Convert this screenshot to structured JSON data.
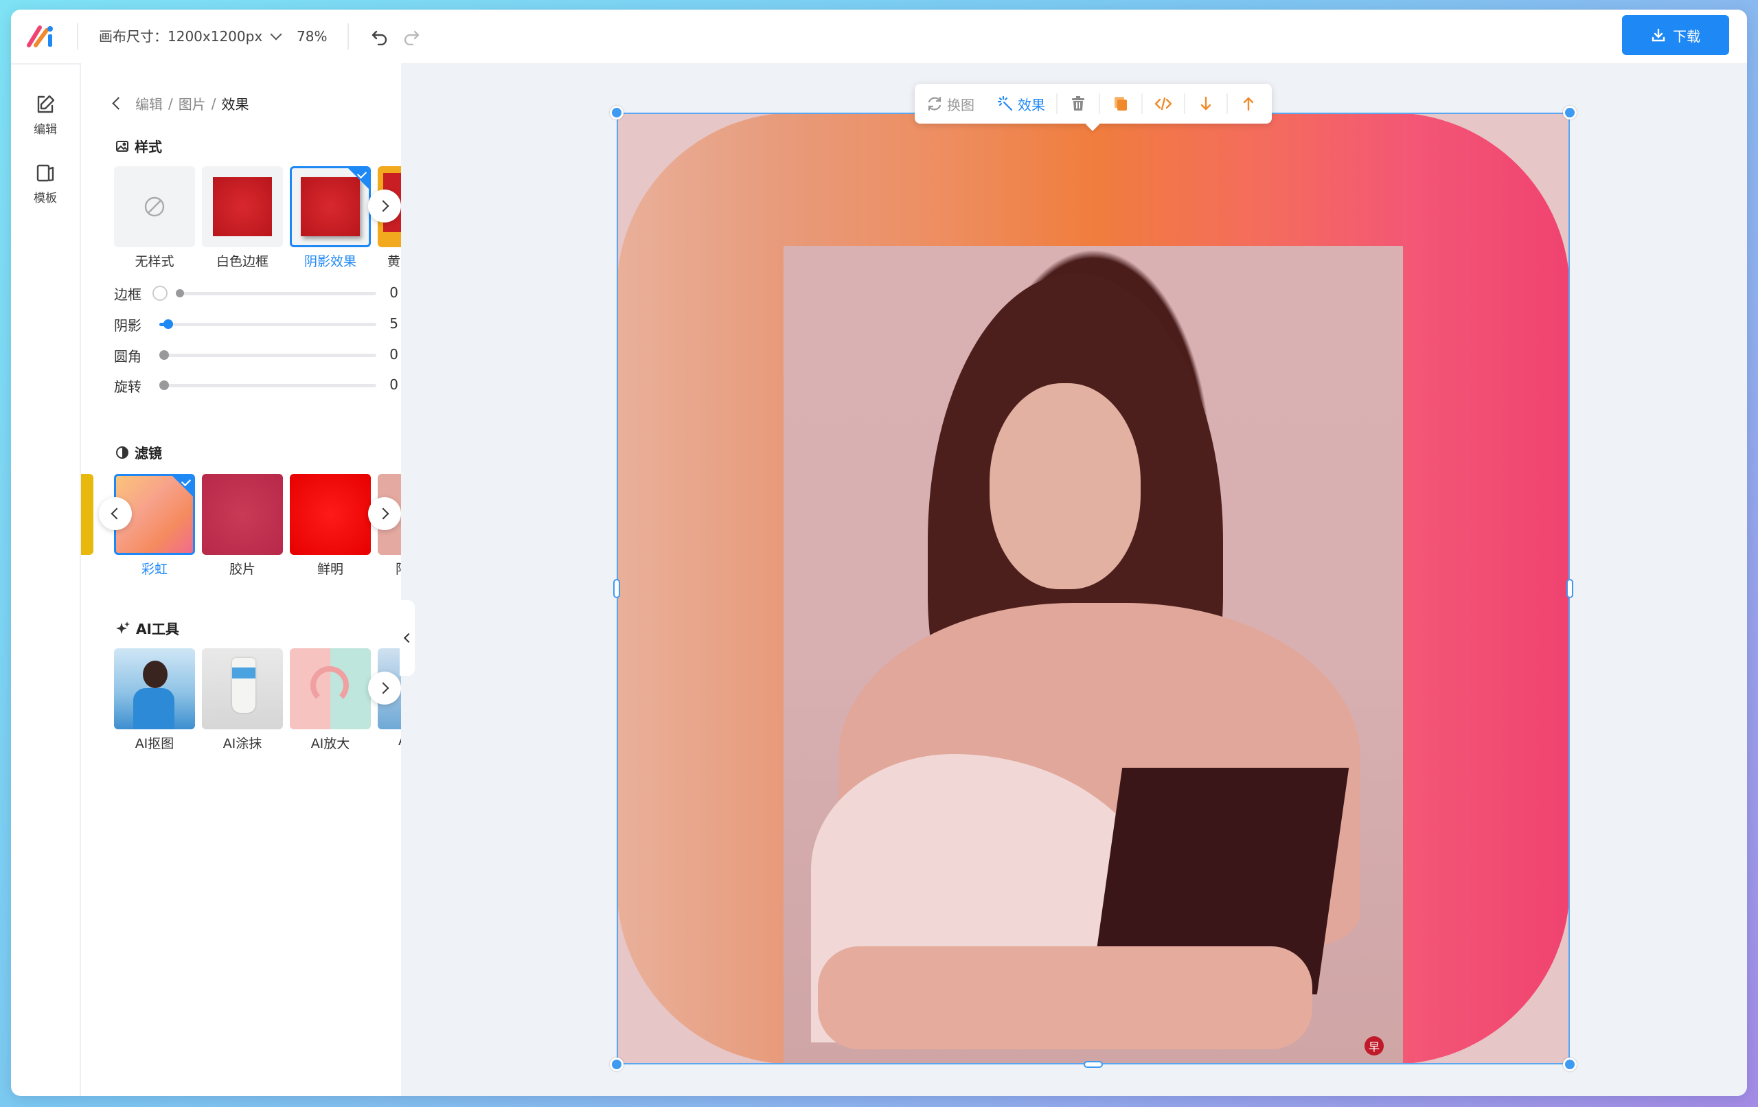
{
  "topbar": {
    "canvas_size": "画布尺寸：1200x1200px",
    "zoom": "78%",
    "download_label": "下载"
  },
  "rail": {
    "items": [
      {
        "label": "编辑",
        "icon": "edit-icon"
      },
      {
        "label": "模板",
        "icon": "template-icon"
      }
    ]
  },
  "panel": {
    "breadcrumb": {
      "part1": "编辑",
      "sep": "/",
      "part2": "图片",
      "current": "效果"
    },
    "style_section": {
      "title": "样式",
      "items": [
        {
          "label": "无样式",
          "selected": false
        },
        {
          "label": "白色边框",
          "selected": false
        },
        {
          "label": "阴影效果",
          "selected": true
        },
        {
          "label": "黄色",
          "selected": false
        }
      ]
    },
    "sliders": [
      {
        "label": "边框",
        "value": "0",
        "toggle": true
      },
      {
        "label": "阴影",
        "value": "5"
      },
      {
        "label": "圆角",
        "value": "0"
      },
      {
        "label": "旋转",
        "value": "0"
      }
    ],
    "filter_section": {
      "title": "滤镜",
      "items": [
        {
          "label": "彩虹",
          "selected": true
        },
        {
          "label": "胶片",
          "selected": false
        },
        {
          "label": "鲜明",
          "selected": false
        },
        {
          "label": "阳",
          "selected": false
        }
      ]
    },
    "ai_section": {
      "title": "AI工具",
      "items": [
        {
          "label": "AI抠图"
        },
        {
          "label": "AI涂抹"
        },
        {
          "label": "AI放大"
        },
        {
          "label": "AI"
        }
      ]
    }
  },
  "floatbar": {
    "replace_label": "换图",
    "effect_label": "效果",
    "icons": [
      "refresh-icon",
      "magic-icon",
      "trash-icon",
      "copy-icon",
      "code-icon",
      "arrow-down-icon",
      "arrow-up-icon"
    ]
  },
  "colors": {
    "accent": "#1e88f5",
    "orange": "#f08a2c"
  }
}
